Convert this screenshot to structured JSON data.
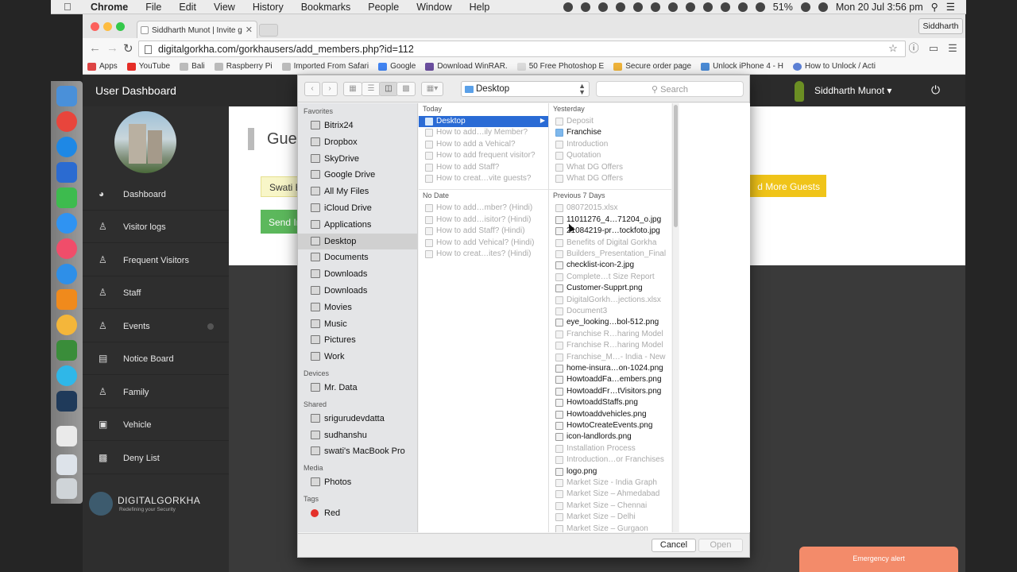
{
  "menubar": {
    "app": "Chrome",
    "items": [
      "File",
      "Edit",
      "View",
      "History",
      "Bookmarks",
      "People",
      "Window",
      "Help"
    ],
    "battery": "51%",
    "clock": "Mon 20 Jul  3:56 pm"
  },
  "chrome": {
    "tab_title": "Siddharth Munot | Invite g",
    "profile": "Siddharth",
    "url": "digitalgorkha.com/gorkhausers/add_members.php?id=112",
    "bookmarks": [
      "Apps",
      "YouTube",
      "Bali",
      "Raspberry Pi",
      "Imported From Safari",
      "Google",
      "Download WinRAR.",
      "50 Free Photoshop E",
      "Secure order page",
      "Unlock iPhone 4 - H",
      "How to Unlock / Acti"
    ]
  },
  "site": {
    "title": "User Dashboard",
    "user": "Siddharth Munot ▾",
    "nav": [
      "Dashboard",
      "Visitor logs",
      "Frequent Visitors",
      "Staff",
      "Events",
      "Notice Board",
      "Family",
      "Vehicle",
      "Deny List"
    ],
    "brand_name": "DIGITALGORKHA",
    "brand_tagline": "Redefining your Security",
    "guests_title": "Guest",
    "guest_name_value": "Swati Bha",
    "send_invite": "Send Invit",
    "add_more": "d More Guests",
    "emergency": "Emergency alert"
  },
  "dialog": {
    "location": "Desktop",
    "search_placeholder": "Search",
    "sections": {
      "favorites": "Favorites",
      "devices": "Devices",
      "shared": "Shared",
      "media": "Media",
      "tags": "Tags"
    },
    "favorites": [
      "Bitrix24",
      "Dropbox",
      "SkyDrive",
      "Google Drive",
      "All My Files",
      "iCloud Drive",
      "Applications",
      "Desktop",
      "Documents",
      "Downloads",
      "Downloads",
      "Movies",
      "Music",
      "Pictures",
      "Work"
    ],
    "devices": [
      "Mr. Data"
    ],
    "shared": [
      "srigurudevdatta",
      "sudhanshu",
      "swati's MacBook Pro"
    ],
    "media": [
      "Photos"
    ],
    "tags": [
      "Red"
    ],
    "col1_groups": {
      "today": "Today",
      "nodate": "No Date"
    },
    "col1_today": [
      "Desktop",
      "How to add…ily Member?",
      "How to add a Vehical?",
      "How to add frequent visitor?",
      "How to add Staff?",
      "How to creat…vite guests?"
    ],
    "col1_nodate": [
      "How to add…mber? (Hindi)",
      "How to add…isitor? (Hindi)",
      "How to add Staff? (Hindi)",
      "How to add Vehical? (Hindi)",
      "How to creat…ites? (Hindi)"
    ],
    "col2_groups": {
      "yesterday": "Yesterday",
      "prev7": "Previous 7 Days"
    },
    "col2_yesterday": [
      "Deposit",
      "Franchise",
      "Introduction",
      "Quotation",
      "What DG Offers",
      "What DG Offers"
    ],
    "col2_prev7": [
      "08072015.xlsx",
      "11011276_4…71204_o.jpg",
      "21084219-pr…tockfoto.jpg",
      "Benefits of Digital Gorkha",
      "Builders_Presentation_Final",
      "checklist-icon-2.jpg",
      "Complete…t Size Report",
      "Customer-Supprt.png",
      "DigitalGorkh…jections.xlsx",
      "Document3",
      "eye_looking…bol-512.png",
      "Franchise R…haring Model",
      "Franchise R…haring Model",
      "Franchise_M…- India - New",
      "home-insura…on-1024.png",
      "HowtoaddFa…embers.png",
      "HowtoaddFr…tVisitors.png",
      "HowtoaddStaffs.png",
      "Howtoaddvehicles.png",
      "HowtoCreateEvents.png",
      "icon-landlords.png",
      "Installation Process",
      "Introduction…or Franchises",
      "logo.png",
      "Market Size - India Graph",
      "Market Size – Ahmedabad",
      "Market Size – Chennai",
      "Market Size – Delhi",
      "Market Size – Gurgaon"
    ],
    "cancel": "Cancel",
    "open": "Open"
  }
}
